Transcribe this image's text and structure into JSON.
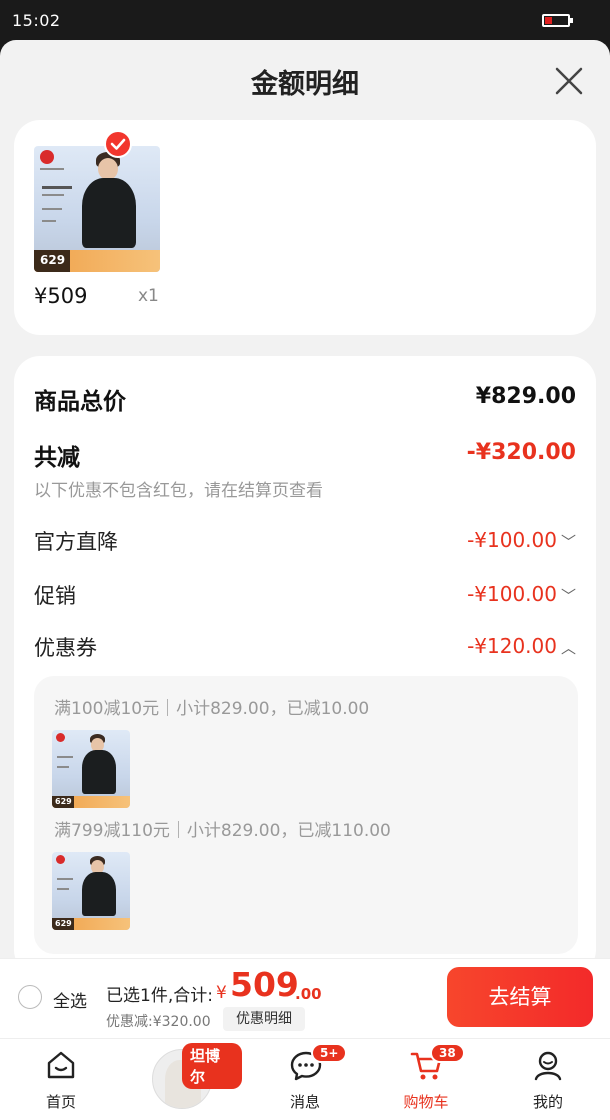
{
  "status_bar": {
    "time": "15:02",
    "battery_level": 0.3
  },
  "sheet": {
    "title": "金额明细"
  },
  "product": {
    "thumb_price": "629",
    "price": "¥509",
    "quantity": "x1"
  },
  "summary": {
    "total_label": "商品总价",
    "total_value": "¥829.00",
    "reduce_label": "共减",
    "reduce_value": "-¥320.00",
    "note": "以下优惠不包含红包，请在结算页查看",
    "items": [
      {
        "label": "官方直降",
        "value": "-¥100.00",
        "chevron": "﹀"
      },
      {
        "label": "促销",
        "value": "-¥100.00",
        "chevron": "﹀"
      },
      {
        "label": "优惠券",
        "value": "-¥120.00",
        "chevron": "︿"
      }
    ],
    "coupons": [
      {
        "text": "满100减10元｜小计829.00，已减10.00",
        "thumb_price": "629"
      },
      {
        "text": "满799减110元｜小计829.00，已减110.00",
        "thumb_price": "629"
      }
    ]
  },
  "bottom_bar": {
    "select_all": "全选",
    "selected_text": "已选1件,合计:",
    "yen": "¥",
    "amount_int": "509",
    "amount_dec": ".00",
    "discount_text": "优惠减:¥320.00",
    "discount_button": "优惠明细",
    "checkout_button": "去结算"
  },
  "tabbar": {
    "tabs": [
      {
        "label": "首页",
        "icon": "home-icon"
      },
      {
        "label": "",
        "icon": "brand-avatar"
      },
      {
        "label": "消息",
        "icon": "message-icon",
        "badge": "5+"
      },
      {
        "label": "购物车",
        "icon": "cart-icon",
        "badge": "38",
        "active": true
      },
      {
        "label": "我的",
        "icon": "user-icon"
      }
    ],
    "brand_tag": "坦博尔"
  },
  "colors": {
    "accent": "#e8321e",
    "background": "#f2f2f2"
  }
}
